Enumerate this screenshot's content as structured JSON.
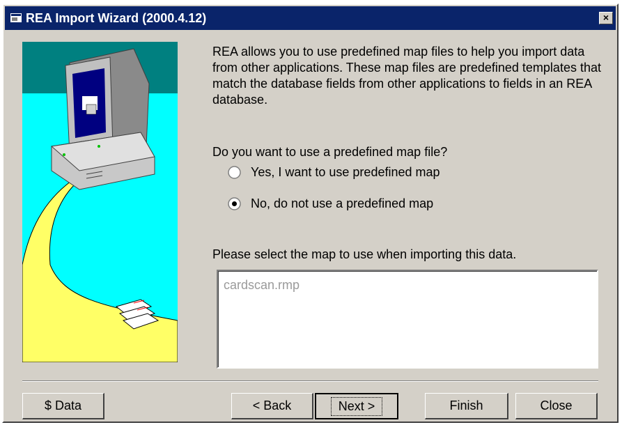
{
  "window": {
    "title": "REA Import Wizard (2000.4.12)",
    "close_glyph": "×"
  },
  "intro_text": "REA allows you to use predefined map files to help you import data from other applications. These map files are predefined templates that match the database fields from other applications to fields in an REA database.",
  "question": "Do you want to use a predefined map file?",
  "options": [
    {
      "label": "Yes, I want to use predefined map",
      "selected": false
    },
    {
      "label": "No, do not use a predefined map",
      "selected": true
    }
  ],
  "map_select_label": "Please select the map to use when importing this data.",
  "map_list": [
    "cardscan.rmp"
  ],
  "buttons": {
    "data": "$ Data",
    "back": "< Back",
    "next": "Next >",
    "finish": "Finish",
    "close": "Close"
  },
  "colors": {
    "titlebar": "#0a246a",
    "dialog_face": "#d4d0c8",
    "illustration_sky": "#00ffff",
    "illustration_band": "#008080",
    "path": "#ffff66"
  }
}
